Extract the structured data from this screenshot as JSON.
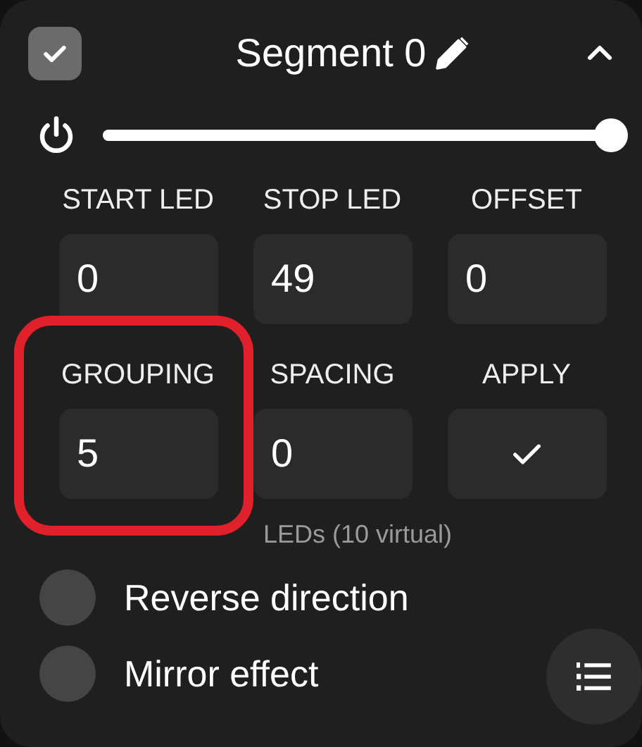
{
  "segment": {
    "title": "Segment 0",
    "checked": true,
    "expanded": true
  },
  "brightness": {
    "level": 1.0
  },
  "fields": [
    {
      "kind": "number",
      "label": "START LED",
      "value": "0",
      "highlighted": false
    },
    {
      "kind": "number",
      "label": "STOP LED",
      "value": "49",
      "highlighted": false
    },
    {
      "kind": "number",
      "label": "OFFSET",
      "value": "0",
      "highlighted": false
    },
    {
      "kind": "number",
      "label": "GROUPING",
      "value": "5",
      "highlighted": true
    },
    {
      "kind": "number",
      "label": "SPACING",
      "value": "0",
      "highlighted": false
    },
    {
      "kind": "button",
      "label": "APPLY",
      "highlighted": false
    }
  ],
  "info": "LEDs (10 virtual)",
  "toggles": [
    {
      "label": "Reverse direction",
      "on": false
    },
    {
      "label": "Mirror effect",
      "on": false
    }
  ]
}
